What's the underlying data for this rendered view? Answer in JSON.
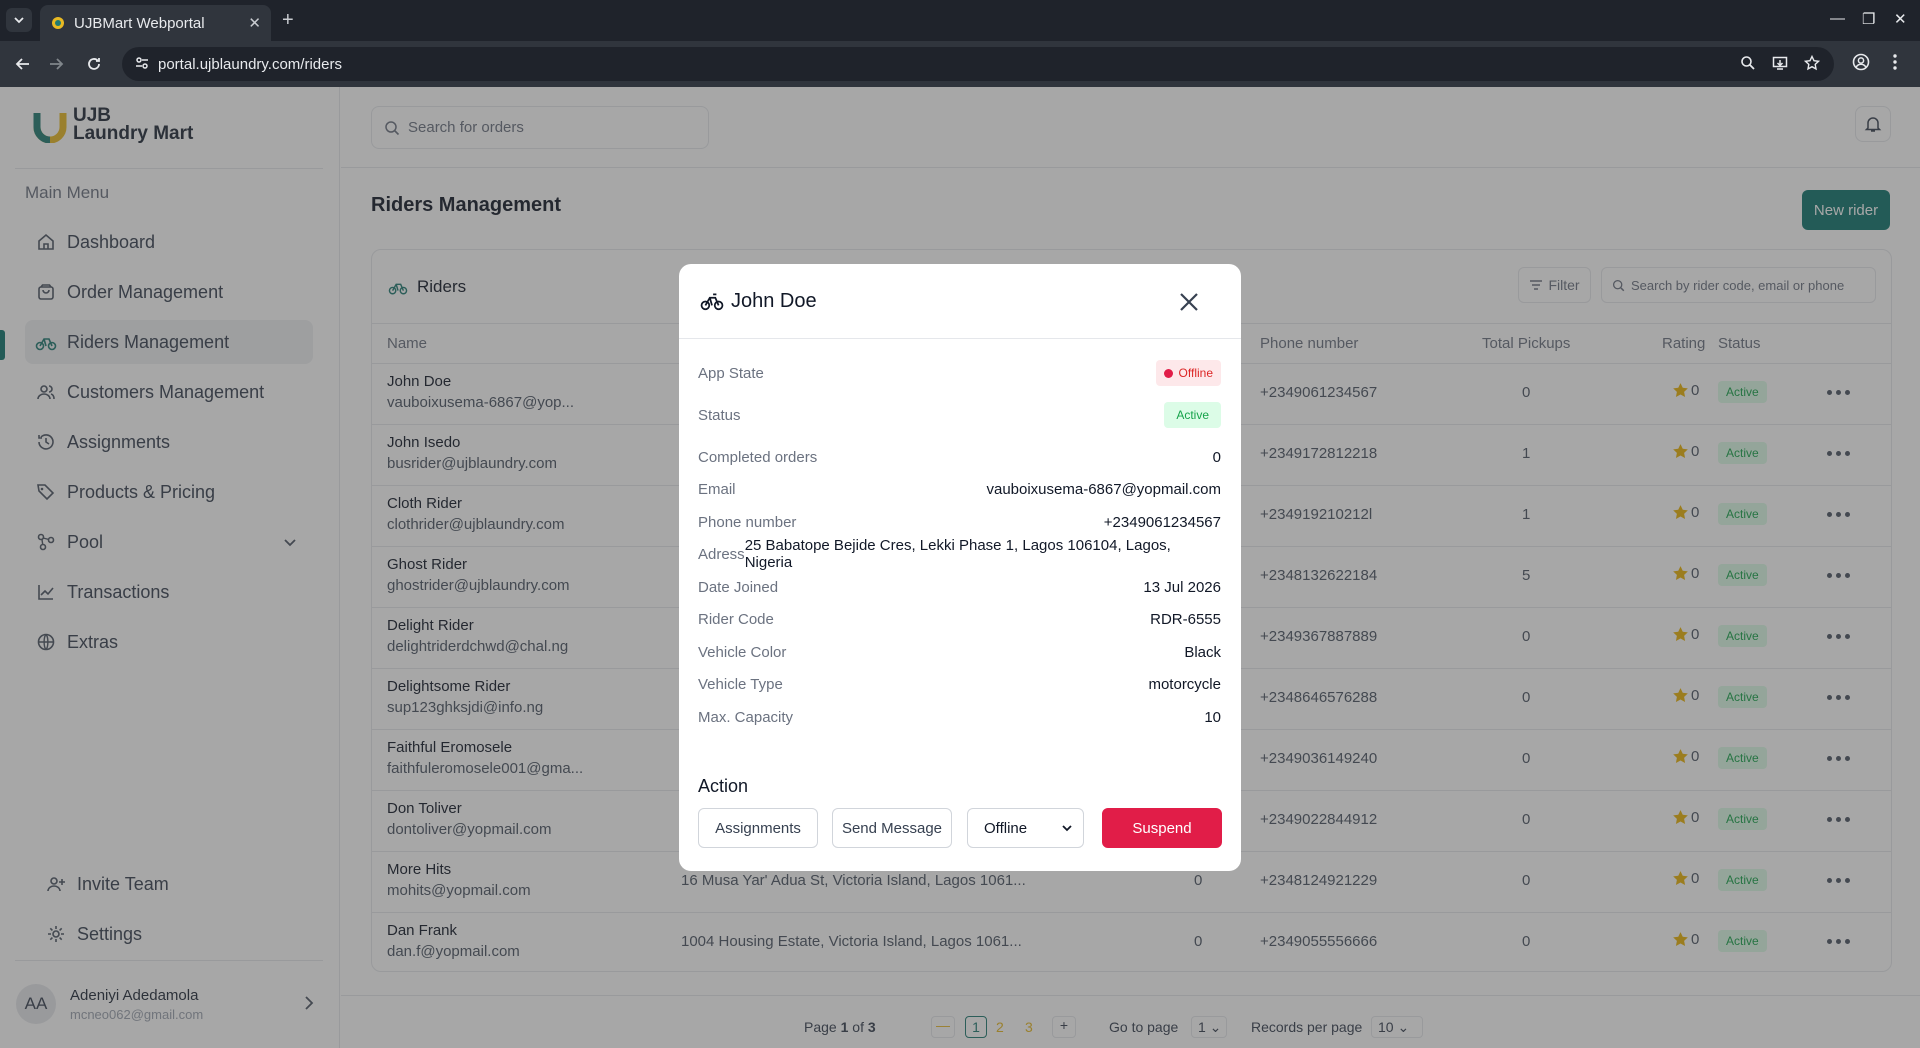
{
  "browser": {
    "tab_title": "UJBMart Webportal",
    "url": "portal.ujblaundry.com/riders"
  },
  "sidebar": {
    "logo_line1": "UJB",
    "logo_line2": "Laundry Mart",
    "menu_title": "Main Menu",
    "items": [
      {
        "label": "Dashboard"
      },
      {
        "label": "Order Management"
      },
      {
        "label": "Riders Management"
      },
      {
        "label": "Customers Management"
      },
      {
        "label": "Assignments"
      },
      {
        "label": "Products & Pricing"
      },
      {
        "label": "Pool"
      },
      {
        "label": "Transactions"
      },
      {
        "label": "Extras"
      }
    ],
    "bottom_items": [
      {
        "label": "Invite Team"
      },
      {
        "label": "Settings"
      }
    ],
    "user": {
      "initials": "AA",
      "name": "Adeniyi Adedamola",
      "email": "mcneo062@gmail.com"
    }
  },
  "header": {
    "search_placeholder": "Search for orders"
  },
  "page": {
    "title": "Riders Management",
    "new_rider_label": "New rider"
  },
  "table": {
    "title": "Riders",
    "filter_label": "Filter",
    "search_placeholder": "Search by rider code, email or phone",
    "columns": [
      "Name",
      "Phone number",
      "Total Pickups",
      "Rating",
      "Status"
    ],
    "rows": [
      {
        "name": "John Doe",
        "email": "vauboixusema-6867@yop...",
        "address": "",
        "completed": "",
        "phone": "+2349061234567",
        "pickups": "0",
        "rating": "0",
        "status": "Active"
      },
      {
        "name": "John Isedo",
        "email": "busrider@ujblaundry.com",
        "address": "",
        "completed": "",
        "phone": "+2349172812218",
        "pickups": "1",
        "rating": "0",
        "status": "Active"
      },
      {
        "name": "Cloth Rider",
        "email": "clothrider@ujblaundry.com",
        "address": "",
        "completed": "",
        "phone": "+234919210212l",
        "pickups": "1",
        "rating": "0",
        "status": "Active"
      },
      {
        "name": "Ghost Rider",
        "email": "ghostrider@ujblaundry.com",
        "address": "",
        "completed": "",
        "phone": "+2348132622184",
        "pickups": "5",
        "rating": "0",
        "status": "Active"
      },
      {
        "name": "Delight Rider",
        "email": "delightriderdchwd@chal.ng",
        "address": "",
        "completed": "",
        "phone": "+2349367887889",
        "pickups": "0",
        "rating": "0",
        "status": "Active"
      },
      {
        "name": "Delightsome Rider",
        "email": "sup123ghksjdi@info.ng",
        "address": "",
        "completed": "",
        "phone": "+2348646576288",
        "pickups": "0",
        "rating": "0",
        "status": "Active"
      },
      {
        "name": "Faithful Eromosele",
        "email": "faithfuleromosele001@gma...",
        "address": "",
        "completed": "",
        "phone": "+2349036149240",
        "pickups": "0",
        "rating": "0",
        "status": "Active"
      },
      {
        "name": "Don Toliver",
        "email": "dontoliver@yopmail.com",
        "address": "",
        "completed": "",
        "phone": "+2349022844912",
        "pickups": "0",
        "rating": "0",
        "status": "Active"
      },
      {
        "name": "More Hits",
        "email": "mohits@yopmail.com",
        "address": "16 Musa Yar' Adua St, Victoria Island, Lagos 1061...",
        "completed": "0",
        "phone": "+2348124921229",
        "pickups": "0",
        "rating": "0",
        "status": "Active"
      },
      {
        "name": "Dan Frank",
        "email": "dan.f@yopmail.com",
        "address": "1004 Housing Estate, Victoria Island, Lagos 1061...",
        "completed": "0",
        "phone": "+2349055556666",
        "pickups": "0",
        "rating": "0",
        "status": "Active"
      }
    ]
  },
  "pagination": {
    "page_text_pre": "Page ",
    "page_current": "1",
    "page_text_mid": " of ",
    "page_total": "3",
    "pages": [
      "1",
      "2",
      "3"
    ],
    "goto_label": "Go to page",
    "goto_value": "1",
    "records_label": "Records per page",
    "records_value": "10"
  },
  "modal": {
    "title": "John Doe",
    "fields": [
      {
        "label": "App State",
        "value": "Offline"
      },
      {
        "label": "Status",
        "value": "Active"
      },
      {
        "label": "Completed orders",
        "value": "0"
      },
      {
        "label": "Email",
        "value": "vauboixusema-6867@yopmail.com"
      },
      {
        "label": "Phone number",
        "value": "+2349061234567"
      },
      {
        "label": "Adress",
        "value": "25 Babatope Bejide Cres, Lekki Phase 1, Lagos 106104, Lagos, Nigeria"
      },
      {
        "label": "Date Joined",
        "value": "13 Jul 2026"
      },
      {
        "label": "Rider Code",
        "value": "RDR-6555"
      },
      {
        "label": "Vehicle Color",
        "value": "Black"
      },
      {
        "label": "Vehicle Type",
        "value": "motorcycle"
      },
      {
        "label": "Max. Capacity",
        "value": "10"
      }
    ],
    "action_title": "Action",
    "btn_assignments": "Assignments",
    "btn_send_message": "Send Message",
    "state_select": "Offline",
    "btn_suspend": "Suspend"
  },
  "colors": {
    "brand": "#0f766e",
    "danger": "#e11d48",
    "star": "#eab308"
  }
}
